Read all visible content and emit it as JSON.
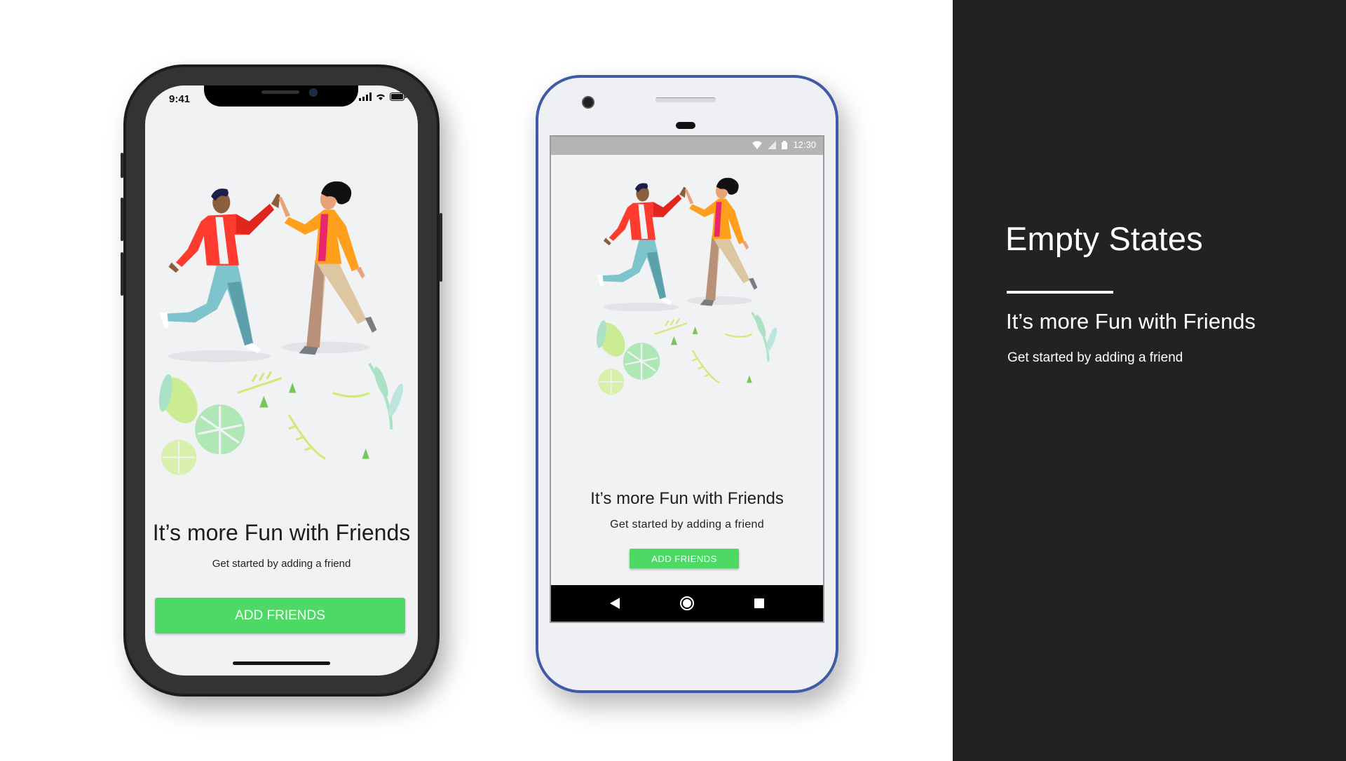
{
  "panel": {
    "title": "Empty States",
    "headline": "It’s more Fun with Friends",
    "subtitle": "Get started by adding a friend"
  },
  "ios": {
    "time": "9:41",
    "heading": "It’s more Fun with Friends",
    "subtitle": "Get started by adding a friend",
    "button_label": "ADD FRIENDS",
    "icons": [
      "signal-icon",
      "wifi-icon",
      "battery-icon"
    ]
  },
  "android": {
    "time": "12:30",
    "heading": "It’s more Fun with Friends",
    "subtitle": "Get started by adding a friend",
    "button_label": "ADD FRIENDS",
    "icons": [
      "wifi-icon",
      "signal-icon",
      "battery-icon",
      "back-icon",
      "home-icon",
      "recents-icon"
    ]
  },
  "colors": {
    "accent_green": "#4cd964",
    "panel_bg": "#222222",
    "android_frame": "#3e5ba8",
    "iphone_frame": "#333336"
  }
}
